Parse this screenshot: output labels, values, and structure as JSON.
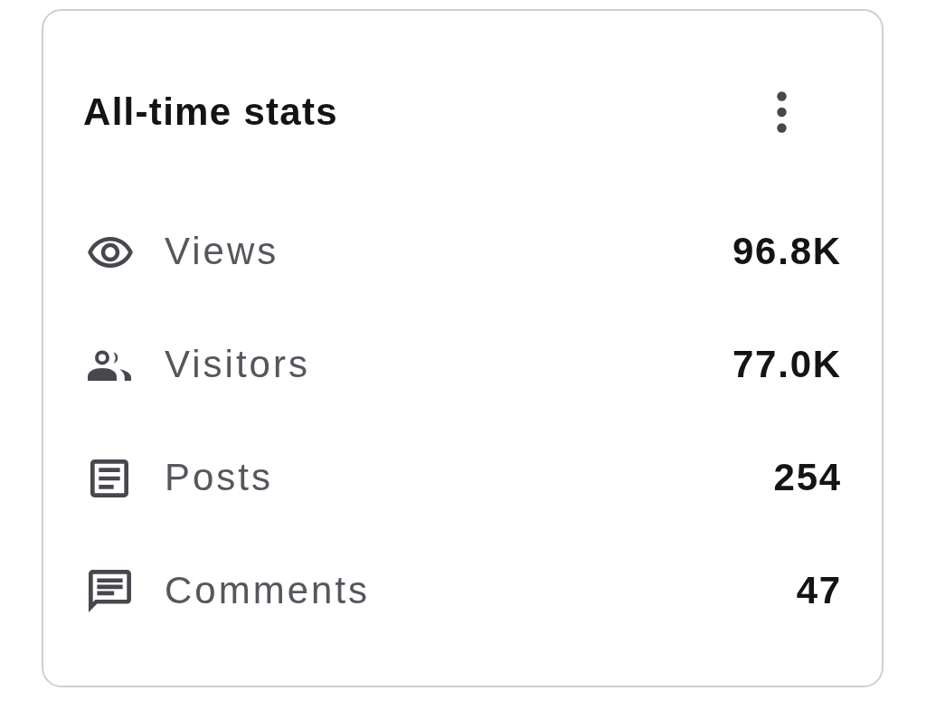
{
  "card": {
    "title": "All-time stats",
    "stats": [
      {
        "kind": "views",
        "label": "Views",
        "value": "96.8K"
      },
      {
        "kind": "visitors",
        "label": "Visitors",
        "value": "77.0K"
      },
      {
        "kind": "posts",
        "label": "Posts",
        "value": "254"
      },
      {
        "kind": "comments",
        "label": "Comments",
        "value": "47"
      }
    ]
  }
}
